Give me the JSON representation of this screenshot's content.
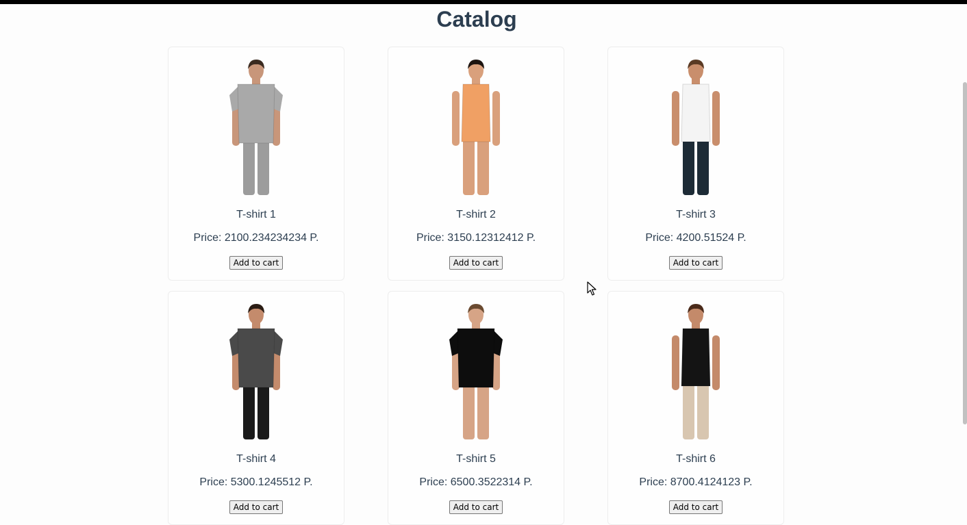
{
  "page": {
    "title": "Catalog"
  },
  "products": [
    {
      "name": "T-shirt 1",
      "price": "Price: 2100.234234234 P.",
      "button": "Add to cart",
      "figure": "man-gray-vneck-tshirt",
      "colors": {
        "top": "#a9a9a9",
        "bottom": "#9c9c9c",
        "skin": "#c8967a",
        "hair": "#3a2a20"
      }
    },
    {
      "name": "T-shirt 2",
      "price": "Price: 3150.12312412 P.",
      "button": "Add to cart",
      "figure": "woman-orange-swimsuit",
      "colors": {
        "top": "#f0a064",
        "bottom": "#f0a064",
        "skin": "#d9a07c",
        "hair": "#1c1410"
      }
    },
    {
      "name": "T-shirt 3",
      "price": "Price: 4200.51524 P.",
      "button": "Add to cart",
      "figure": "woman-white-tank-top",
      "colors": {
        "top": "#f4f4f4",
        "bottom": "#1d2b36",
        "skin": "#c98e6c",
        "hair": "#5a3a24"
      }
    },
    {
      "name": "T-shirt 4",
      "price": "Price: 5300.1245512 P.",
      "button": "Add to cart",
      "figure": "man-dark-gray-tshirt",
      "colors": {
        "top": "#4a4a4a",
        "bottom": "#1a1a1a",
        "skin": "#c48b6c",
        "hair": "#2a1c14"
      }
    },
    {
      "name": "T-shirt 5",
      "price": "Price: 6500.3522314 P.",
      "button": "Add to cart",
      "figure": "woman-black-tshirt",
      "colors": {
        "top": "#0d0d0d",
        "bottom": "#0d0d0d",
        "skin": "#d6a486",
        "hair": "#6a4a30"
      }
    },
    {
      "name": "T-shirt 6",
      "price": "Price: 8700.4124123 P.",
      "button": "Add to cart",
      "figure": "woman-black-sleeveless-top",
      "colors": {
        "top": "#141414",
        "bottom": "#d8c6b0",
        "skin": "#c48a6a",
        "hair": "#4a2a1a"
      }
    }
  ]
}
